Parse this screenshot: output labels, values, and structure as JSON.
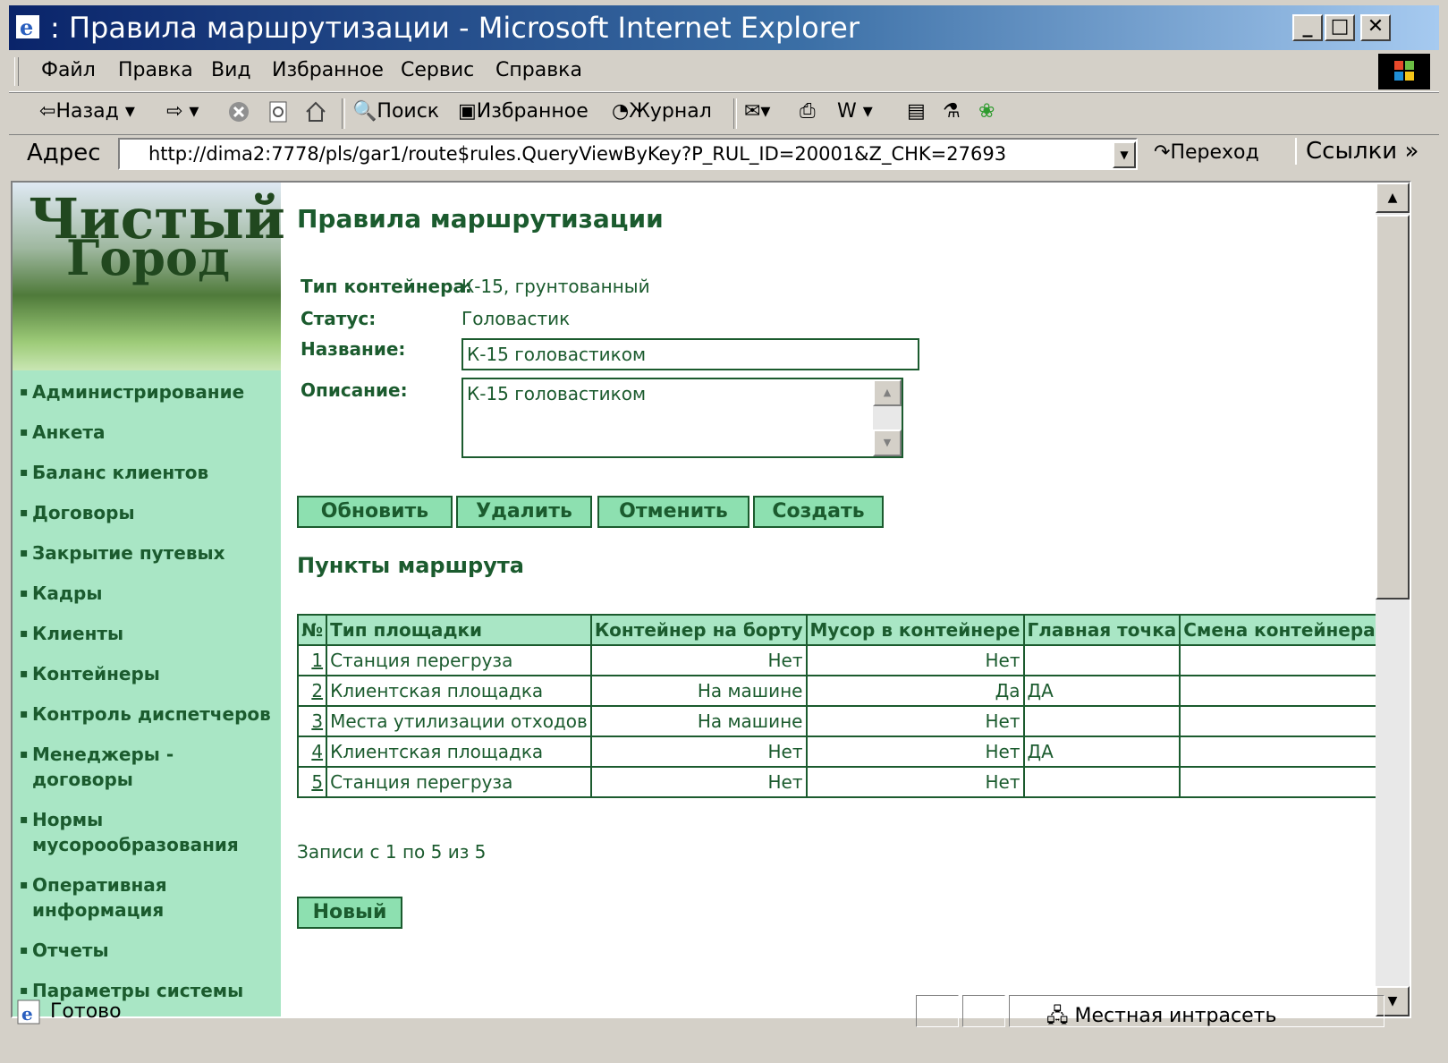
{
  "window": {
    "title": ": Правила маршрутизации - Microsoft Internet Explorer"
  },
  "menu": [
    "Файл",
    "Правка",
    "Вид",
    "Избранное",
    "Сервис",
    "Справка"
  ],
  "toolbar": {
    "back": "Назад",
    "search": "Поиск",
    "favorites": "Избранное",
    "history": "Журнал"
  },
  "address": {
    "label": "Адрес",
    "url": "http://dima2:7778/pls/gar1/route$rules.QueryViewByKey?P_RUL_ID=20001&Z_CHK=27693",
    "go": "Переход",
    "links": "Ссылки"
  },
  "logo": {
    "line1": "Чистый",
    "line2": "Город"
  },
  "sidebar": {
    "items": [
      "Администрирование",
      "Анкета",
      "Баланс клиентов",
      "Договоры",
      "Закрытие путевых",
      "Кадры",
      "Клиенты",
      "Контейнеры",
      "Контроль диспетчеров",
      "Менеджеры - договоры",
      "Нормы мусорообразования",
      "Оперативная информация",
      "Отчеты",
      "Параметры системы"
    ]
  },
  "page": {
    "title": "Правила маршрутизации",
    "container_type_label": "Тип контейнера:",
    "container_type_value": "К-15, грунтованный",
    "status_label": "Статус:",
    "status_value": "Головастик",
    "name_label": "Название:",
    "name_value": "К-15 головастиком",
    "desc_label": "Описание:",
    "desc_value": "К-15 головастиком",
    "buttons": {
      "update": "Обновить",
      "delete": "Удалить",
      "cancel": "Отменить",
      "create": "Создать"
    },
    "subtitle": "Пункты маршрута",
    "table": {
      "headers": [
        "№",
        "Тип площадки",
        "Контейнер на борту",
        "Мусор в контейнере",
        "Главная точка",
        "Смена контейнера"
      ],
      "rows": [
        [
          "1",
          "Станция перегруза",
          "Нет",
          "Нет",
          "",
          ""
        ],
        [
          "2",
          "Клиентская площадка",
          "На машине",
          "Да",
          "ДА",
          ""
        ],
        [
          "3",
          "Места утилизации отходов",
          "На машине",
          "Нет",
          "",
          ""
        ],
        [
          "4",
          "Клиентская площадка",
          "Нет",
          "Нет",
          "ДА",
          ""
        ],
        [
          "5",
          "Станция перегруза",
          "Нет",
          "Нет",
          "",
          ""
        ]
      ]
    },
    "records": "Записи с 1 по 5 из 5",
    "new_button": "Новый"
  },
  "status": {
    "text": "Готово",
    "zone": "Местная интрасеть"
  }
}
